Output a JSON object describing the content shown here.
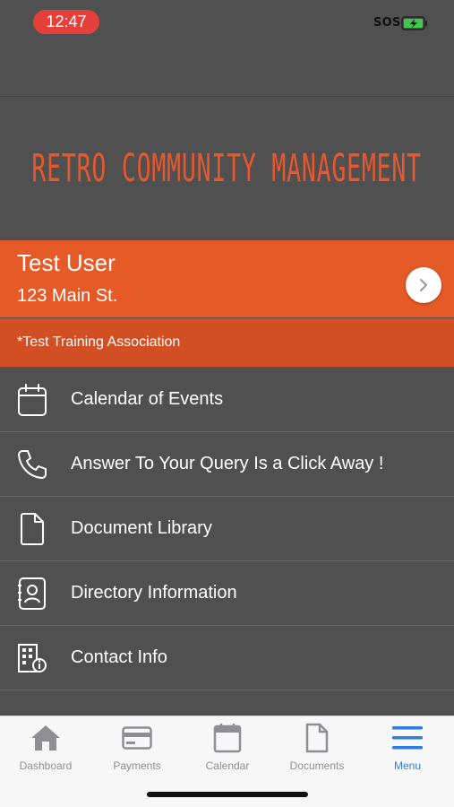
{
  "status_bar": {
    "time": "12:47",
    "sos": "SOS"
  },
  "brand": {
    "name": "RETRO COMMUNITY MANAGEMENT",
    "color": "#e8582c"
  },
  "user": {
    "name": "Test User",
    "address": "123 Main St.",
    "association": "*Test Training Association"
  },
  "menu": {
    "items": [
      {
        "label": "Calendar of Events",
        "icon": "calendar-icon"
      },
      {
        "label": "Answer To Your Query Is a Click Away !",
        "icon": "phone-icon"
      },
      {
        "label": "Document Library",
        "icon": "document-icon"
      },
      {
        "label": "Directory Information",
        "icon": "contact-card-icon"
      },
      {
        "label": "Contact Info",
        "icon": "building-info-icon"
      }
    ]
  },
  "tabs": [
    {
      "label": "Dashboard",
      "icon": "home-icon",
      "active": false
    },
    {
      "label": "Payments",
      "icon": "credit-card-icon",
      "active": false
    },
    {
      "label": "Calendar",
      "icon": "calendar-icon",
      "active": false
    },
    {
      "label": "Documents",
      "icon": "document-icon",
      "active": false
    },
    {
      "label": "Menu",
      "icon": "hamburger-menu-icon",
      "active": true
    }
  ],
  "colors": {
    "background": "#505050",
    "accent_orange": "#e55a27",
    "association_orange": "#d14f23",
    "active_tab": "#2f7de1",
    "time_pill": "#e5413a"
  }
}
